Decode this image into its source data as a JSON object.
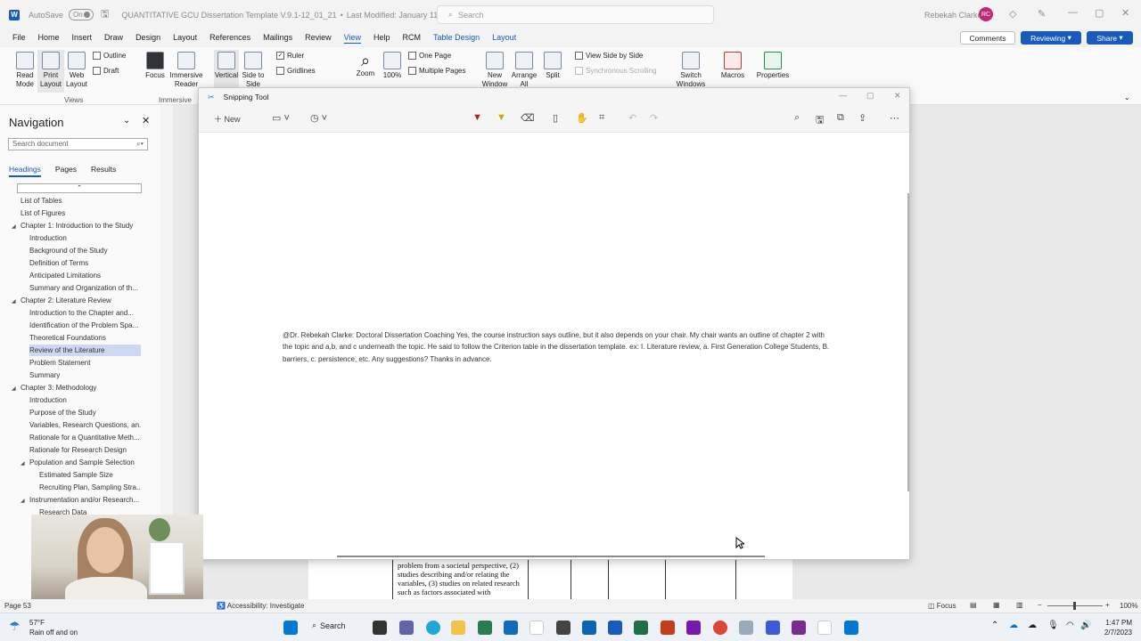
{
  "titlebar": {
    "autosave_label": "AutoSave",
    "autosave_state": "On",
    "document_title": "QUANTITATIVE GCU Dissertation Template V.9.1-12_01_21",
    "last_modified": "Last Modified: January 11",
    "search_placeholder": "Search",
    "user_name": "Rebekah Clarke",
    "user_initials": "RC"
  },
  "menu": {
    "items": [
      "File",
      "Home",
      "Insert",
      "Draw",
      "Design",
      "Layout",
      "References",
      "Mailings",
      "Review",
      "View",
      "Help",
      "RCM",
      "Table Design",
      "Layout"
    ],
    "comments": "Comments",
    "reviewing": "Reviewing",
    "share": "Share"
  },
  "ribbon": {
    "read_mode": "Read Mode",
    "print_layout": "Print Layout",
    "web_layout": "Web Layout",
    "outline": "Outline",
    "draft": "Draft",
    "views_group": "Views",
    "focus": "Focus",
    "immersive_reader": "Immersive Reader",
    "immersive_group": "Immersive",
    "vertical": "Vertical",
    "side_to_side": "Side to Side",
    "ruler": "Ruler",
    "gridlines": "Gridlines",
    "zoom": "Zoom",
    "zoom_100": "100%",
    "one_page": "One Page",
    "multiple_pages": "Multiple Pages",
    "new_window": "New Window",
    "arrange_all": "Arrange All",
    "split": "Split",
    "view_side_by_side": "View Side by Side",
    "synchronous_scrolling": "Synchronous Scrolling",
    "switch_windows": "Switch Windows",
    "macros": "Macros",
    "properties": "Properties"
  },
  "navigation": {
    "title": "Navigation",
    "search_placeholder": "Search document",
    "tabs": [
      "Headings",
      "Pages",
      "Results"
    ],
    "headings": [
      {
        "label": "List of Tables",
        "level": 1,
        "caret": false
      },
      {
        "label": "List of Figures",
        "level": 1,
        "caret": false
      },
      {
        "label": "Chapter 1: Introduction to the Study",
        "level": 1,
        "caret": true
      },
      {
        "label": "Introduction",
        "level": 2,
        "caret": false
      },
      {
        "label": "Background of the Study",
        "level": 2,
        "caret": false
      },
      {
        "label": "Definition of Terms",
        "level": 2,
        "caret": false
      },
      {
        "label": "Anticipated Limitations",
        "level": 2,
        "caret": false
      },
      {
        "label": "Summary and Organization of th...",
        "level": 2,
        "caret": false
      },
      {
        "label": "Chapter 2: Literature Review",
        "level": 1,
        "caret": true
      },
      {
        "label": "Introduction to the Chapter and...",
        "level": 2,
        "caret": false
      },
      {
        "label": "Identification of the Problem Spa...",
        "level": 2,
        "caret": false
      },
      {
        "label": "Theoretical Foundations",
        "level": 2,
        "caret": false
      },
      {
        "label": "Review of the Literature",
        "level": 2,
        "caret": false,
        "selected": true
      },
      {
        "label": "Problem Statement",
        "level": 2,
        "caret": false
      },
      {
        "label": "Summary",
        "level": 2,
        "caret": false
      },
      {
        "label": "Chapter 3: Methodology",
        "level": 1,
        "caret": true
      },
      {
        "label": "Introduction",
        "level": 2,
        "caret": false
      },
      {
        "label": "Purpose of the Study",
        "level": 2,
        "caret": false
      },
      {
        "label": "Variables, Research Questions, an...",
        "level": 2,
        "caret": false
      },
      {
        "label": "Rationale for a Quantitative Meth...",
        "level": 2,
        "caret": false
      },
      {
        "label": "Rationale for Research Design",
        "level": 2,
        "caret": false
      },
      {
        "label": "Population and Sample Selection",
        "level": 2,
        "caret": true
      },
      {
        "label": "Estimated Sample Size",
        "level": 3,
        "caret": false
      },
      {
        "label": "Recruiting Plan, Sampling Stra...",
        "level": 3,
        "caret": false
      },
      {
        "label": "Instrumentation and/or Research...",
        "level": 2,
        "caret": true
      },
      {
        "label": "Research Data",
        "level": 3,
        "caret": false
      }
    ]
  },
  "snipping_tool": {
    "title": "Snipping Tool",
    "new_button": "New",
    "content_text": "@Dr. Rebekah Clarke: Doctoral Dissertation Coaching  Yes, the course instruction says outline, but it also depends on your chair.   My chair wants an outline of chapter 2 with the topic and a,b, and c underneath the topic. He said to follow the Criterion table in the dissertation template. ex: I. Literature review, a. First Generation College Students, B. barriers, c. persistence, etc. Any suggestions? Thanks in advance."
  },
  "document": {
    "table_cell_text": "problem from a societal perspective, (2) studies describing and/or relating the variables, (3) studies on related research such as factors associated with"
  },
  "statusbar": {
    "page": "Page 53",
    "accessibility": "Accessibility: Investigate",
    "focus": "Focus",
    "zoom": "100%"
  },
  "taskbar": {
    "weather_temp": "57°F",
    "weather_desc": "Rain off and on",
    "search": "Search",
    "time": "1:47 PM",
    "date": "2/7/2023"
  },
  "colors": {
    "word_blue": "#185abd",
    "avatar": "#c0267a",
    "selected_heading": "#cfd8f3"
  }
}
